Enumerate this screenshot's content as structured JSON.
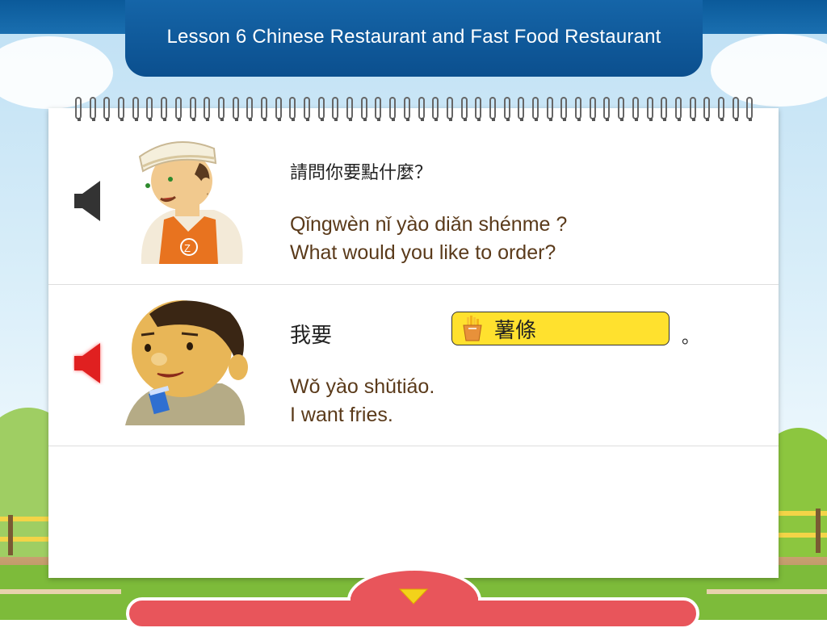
{
  "header": {
    "title": "Lesson 6   Chinese Restaurant and Fast Food Restaurant"
  },
  "dialogue": [
    {
      "speaker_state": "inactive",
      "chinese": "請問你要點什麼？",
      "pinyin": "Qǐngwèn nǐ yào diǎn shénme ?",
      "english": "What would you like to order?"
    },
    {
      "speaker_state": "active",
      "chinese_prefix": "我要",
      "answer": "薯條",
      "chinese_suffix": "。",
      "pinyin": "Wǒ yào shǔtiáo.",
      "english": "I want fries."
    }
  ],
  "icons": {
    "audio_inactive": "speaker-icon",
    "audio_active": "speaker-active-icon",
    "answer": "fries-icon",
    "next": "down-arrow-icon"
  },
  "colors": {
    "header_blue": "#0b4f8e",
    "answer_yellow": "#ffe12e",
    "text_brown": "#5a3a1a",
    "speaker_active_red": "#e02020",
    "bottom_red": "#e8555b",
    "arrow_yellow": "#f3d21a"
  }
}
